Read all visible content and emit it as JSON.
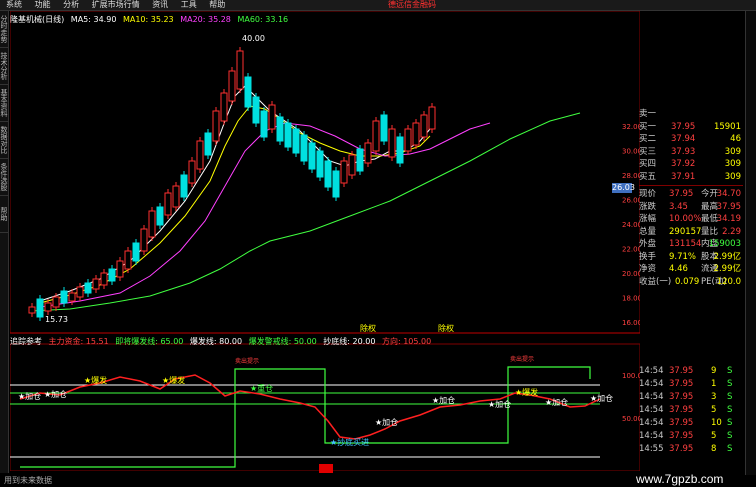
{
  "menu": [
    "系统",
    "功能",
    "分析",
    "扩展市场行情",
    "资讯",
    "工具",
    "帮助"
  ],
  "window_title": "德远信金融码",
  "left_tabs": [
    "分时走势",
    "技术分析",
    "基本资料",
    "数据对比",
    "条件选股",
    "帮助"
  ],
  "stock_title": "隆基机械(日线)",
  "ma": [
    {
      "label": "MA5: 34.90",
      "color": "#ffffff"
    },
    {
      "label": "MA10: 35.23",
      "color": "#ffff00"
    },
    {
      "label": "MA20: 35.28",
      "color": "#ff40ff"
    },
    {
      "label": "MA60: 33.16",
      "color": "#40ff40"
    }
  ],
  "price_axis": [
    "32.00",
    "30.00",
    "28.00",
    "26.00",
    "24.00",
    "22.00",
    "20.00",
    "18.00",
    "16.00"
  ],
  "high_label": "40.00",
  "low_label": "15.73",
  "current_price_tag": "26.03",
  "bottom_markers": [
    "除权",
    "除权"
  ],
  "sub_title": "追踪参考",
  "sub_legend": [
    {
      "label": "主力资金: 15.51",
      "color": "#ff4040"
    },
    {
      "label": "即将爆发线: 65.00",
      "color": "#40ff40"
    },
    {
      "label": "爆发线: 80.00",
      "color": "#ffffff"
    },
    {
      "label": "爆发警戒线: 50.00",
      "color": "#40ff40"
    },
    {
      "label": "抄底线: 20.00",
      "color": "#ffffff"
    },
    {
      "label": "方向: 105.00",
      "color": "#ff4040"
    }
  ],
  "sub_axis": [
    "100.0",
    "50.00"
  ],
  "annotations": {
    "buy": "加仓",
    "explode": "爆发",
    "heavy": "重仓",
    "explode2": "爆发",
    "bottom": "抄底买进",
    "sell_top": "卖出提示"
  },
  "quote": {
    "book": [
      {
        "name": "卖一",
        "price": "",
        "vol": ""
      },
      {
        "name": "买一",
        "price": "37.95",
        "vol": "15901"
      },
      {
        "name": "买二",
        "price": "37.94",
        "vol": "46"
      },
      {
        "name": "买三",
        "price": "37.93",
        "vol": "309"
      },
      {
        "name": "买四",
        "price": "37.92",
        "vol": "309"
      },
      {
        "name": "买五",
        "price": "37.91",
        "vol": "309"
      }
    ],
    "stats": [
      {
        "l": "现价",
        "lv": "37.95",
        "r": "今开",
        "rv": "34.70"
      },
      {
        "l": "涨跌",
        "lv": "3.45",
        "r": "最高",
        "rv": "37.95"
      },
      {
        "l": "涨幅",
        "lv": "10.00%",
        "r": "最低",
        "rv": "34.19"
      },
      {
        "l": "总量",
        "lv": "290157",
        "r": "量比",
        "rv": "2.29"
      },
      {
        "l": "外盘",
        "lv": "131154",
        "r": "内盘",
        "rv": "159003"
      },
      {
        "l": "换手",
        "lv": "9.71%",
        "r": "股本",
        "rv": "2.99亿"
      },
      {
        "l": "净资",
        "lv": "4.46",
        "r": "流通",
        "rv": "2.99亿"
      },
      {
        "l": "收益(一)",
        "lv": "0.079",
        "r": "PE(动)",
        "rv": "120.0"
      }
    ]
  },
  "ticks": [
    {
      "t": "14:54",
      "p": "37.95",
      "v": "9",
      "s": "S"
    },
    {
      "t": "14:54",
      "p": "37.95",
      "v": "1",
      "s": "S"
    },
    {
      "t": "14:54",
      "p": "37.95",
      "v": "3",
      "s": "S"
    },
    {
      "t": "14:54",
      "p": "37.95",
      "v": "5",
      "s": "S"
    },
    {
      "t": "14:54",
      "p": "37.95",
      "v": "10",
      "s": "S"
    },
    {
      "t": "14:54",
      "p": "37.95",
      "v": "5",
      "s": "S"
    },
    {
      "t": "14:55",
      "p": "37.95",
      "v": "8",
      "s": "S"
    }
  ],
  "status_text": "用到未来数据",
  "watermark": "www.7gpzb.com"
}
